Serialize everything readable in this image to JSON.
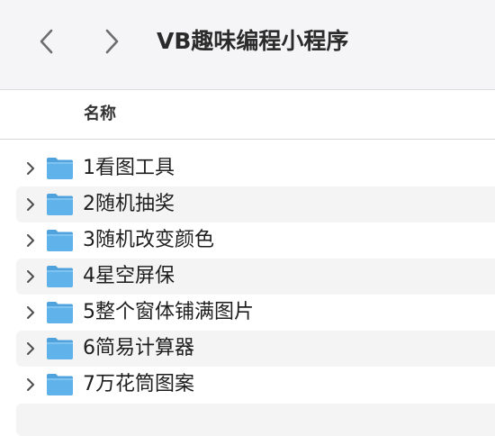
{
  "window": {
    "title": "VB趣味编程小程序"
  },
  "toolbar": {
    "back_icon": "chevron-left-icon",
    "forward_icon": "chevron-right-icon"
  },
  "columns": {
    "name": "名称"
  },
  "folders": [
    {
      "name": "1看图工具"
    },
    {
      "name": "2随机抽奖"
    },
    {
      "name": "3随机改变颜色"
    },
    {
      "name": "4星空屏保"
    },
    {
      "name": "5整个窗体铺满图片"
    },
    {
      "name": "6简易计算器"
    },
    {
      "name": "7万花筒图案"
    }
  ],
  "colors": {
    "folder": "#5fb2ea",
    "folder_tab": "#4fa2dc",
    "toolbar_bg": "#f5f5f7",
    "row_alt_bg": "#f4f4f5"
  }
}
